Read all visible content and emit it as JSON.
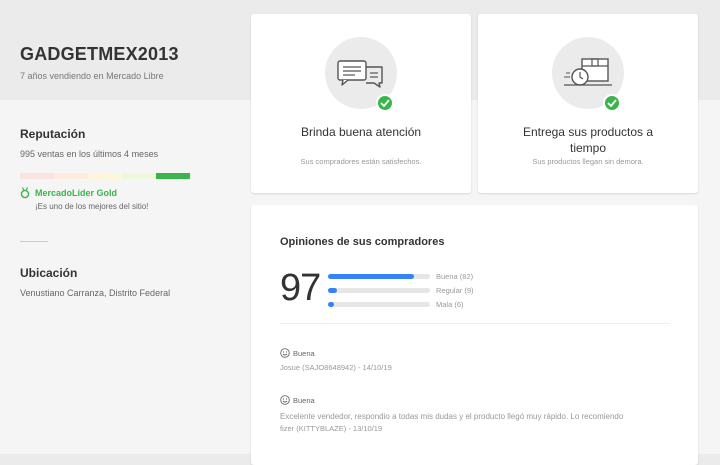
{
  "seller": {
    "name": "GADGETMEX2013",
    "years": "7 años vendiendo en Mercado Libre"
  },
  "reputation": {
    "title": "Reputación",
    "sales": "995 ventas en los últimos 4 meses",
    "thermometer_level": 5,
    "thermometer_max": 5,
    "medal_name": "MercadoLíder Gold",
    "medal_desc": "¡Es uno de los mejores del sitio!"
  },
  "location": {
    "title": "Ubicación",
    "value": "Venustiano Carranza, Distrito Federal"
  },
  "cards": [
    {
      "title": "Brinda buena atención",
      "subtitle": "Sus compradores están satisfechos.",
      "icon": "chat-bubbles-icon"
    },
    {
      "title": "Entrega sus productos a tiempo",
      "subtitle": "Sus productos llegan sin demora.",
      "icon": "delivery-box-clock-icon"
    }
  ],
  "opinions": {
    "title": "Opiniones de sus compradores",
    "score": "97",
    "rows": [
      {
        "label": "Buena (82)",
        "count": 82
      },
      {
        "label": "Regular (9)",
        "count": 9
      },
      {
        "label": "Mala (6)",
        "count": 6
      }
    ],
    "reviews": [
      {
        "kind": "Buena",
        "text": "",
        "meta": "Josue (SAJO8648942) - 14/10/19"
      },
      {
        "kind": "Buena",
        "text": "Excelente vendedor, respondio a todas mis dudas y el producto llegó muy rápido. Lo recomiendo",
        "meta": "fizer (KITTYBLAZE) - 13/10/19"
      }
    ]
  },
  "colors": {
    "accent_green": "#39b54a",
    "bar_blue": "#3483fa"
  }
}
